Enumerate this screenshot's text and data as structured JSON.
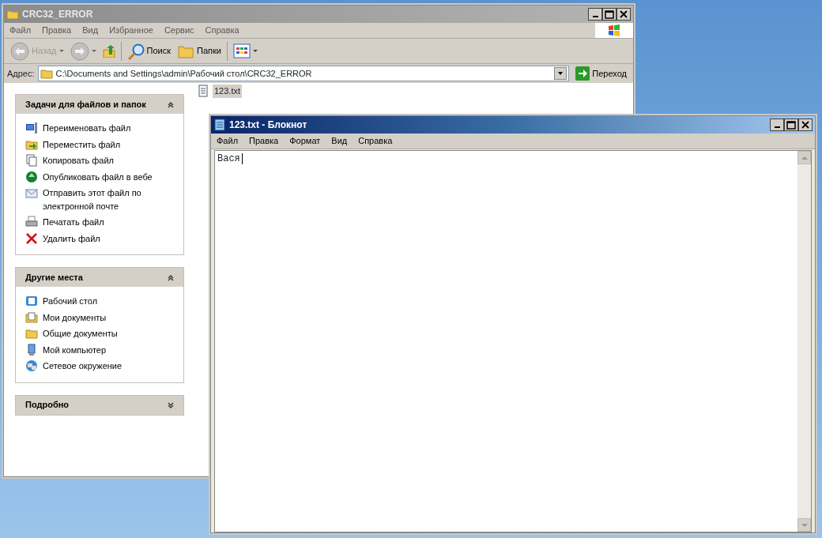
{
  "explorer": {
    "title": "CRC32_ERROR",
    "active": false,
    "menu": [
      "Файл",
      "Правка",
      "Вид",
      "Избранное",
      "Сервис",
      "Справка"
    ],
    "toolbar": [
      {
        "kind": "back",
        "label": "Назад",
        "disabled": true
      },
      {
        "kind": "forward",
        "disabled": true
      },
      {
        "kind": "up",
        "disabled": false
      },
      {
        "kind": "search",
        "label": "Поиск",
        "disabled": false
      },
      {
        "kind": "folders",
        "label": "Папки",
        "disabled": false
      },
      {
        "kind": "views",
        "disabled": false
      }
    ],
    "address": {
      "label": "Адрес:",
      "value": "C:\\Documents and Settings\\admin\\Рабочий стол\\CRC32_ERROR",
      "go": "Переход"
    },
    "panels": [
      {
        "title": "Задачи для файлов и папок",
        "expanded": true,
        "items": [
          {
            "label": "Переименовать файл"
          },
          {
            "label": "Переместить файл"
          },
          {
            "label": "Копировать файл"
          },
          {
            "label": "Опубликовать файл в вебе"
          },
          {
            "label": "Отправить этот файл по электронной почте"
          },
          {
            "label": "Печатать файл"
          },
          {
            "label": "Удалить файл"
          }
        ]
      },
      {
        "title": "Другие места",
        "expanded": true,
        "items": [
          {
            "label": "Рабочий стол"
          },
          {
            "label": "Мои документы"
          },
          {
            "label": "Общие документы"
          },
          {
            "label": "Мой компьютер"
          },
          {
            "label": "Сетевое окружение"
          }
        ]
      },
      {
        "title": "Подробно",
        "expanded": false
      }
    ],
    "files": [
      {
        "name": "123.txt",
        "selected": true
      }
    ]
  },
  "notepad": {
    "title": "123.txt - Блокнот",
    "active": true,
    "menu": [
      "Файл",
      "Правка",
      "Формат",
      "Вид",
      "Справка"
    ],
    "text": "Вася"
  }
}
